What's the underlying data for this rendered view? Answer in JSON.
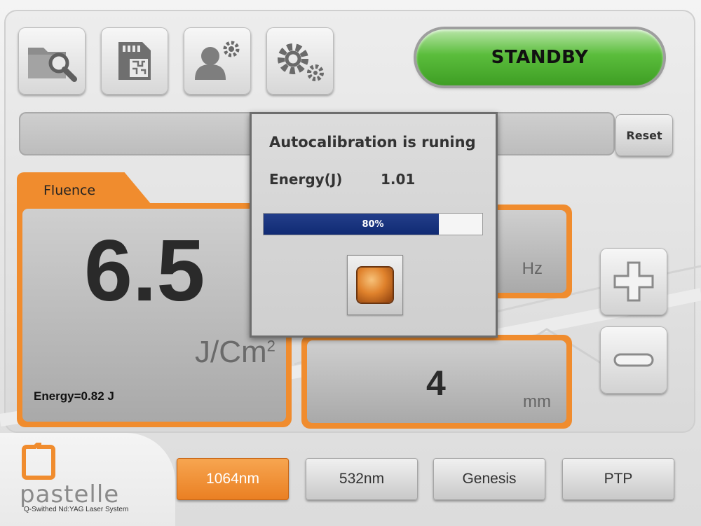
{
  "toolbar": {
    "icons": [
      "folder-search-icon",
      "sd-card-icon",
      "user-settings-icon",
      "gear-settings-icon"
    ],
    "standby_label": "STANDBY",
    "standby_color": "#4caf30"
  },
  "status_bar": {
    "reset_label": "Reset"
  },
  "fluence": {
    "tab_label": "Fluence",
    "value": "6.5",
    "unit": "J/Cm",
    "unit_sup": "2",
    "energy_readout": "Energy=0.82 J"
  },
  "frequency": {
    "unit": "Hz"
  },
  "spot_size": {
    "value": "4",
    "unit": "mm"
  },
  "dialog": {
    "title": "Autocalibration is runing",
    "energy_label": "Energy(J)",
    "energy_value": "1.01",
    "progress_percent": 80,
    "progress_label": "80%"
  },
  "wavelength_tabs": [
    {
      "label": "1064nm",
      "active": true
    },
    {
      "label": "532nm",
      "active": false
    },
    {
      "label": "Genesis",
      "active": false
    },
    {
      "label": "PTP",
      "active": false
    }
  ],
  "brand": {
    "name": "pastelle",
    "subtitle": "Q-Swithed Nd:YAG Laser System",
    "accent": "#f08c2e"
  }
}
